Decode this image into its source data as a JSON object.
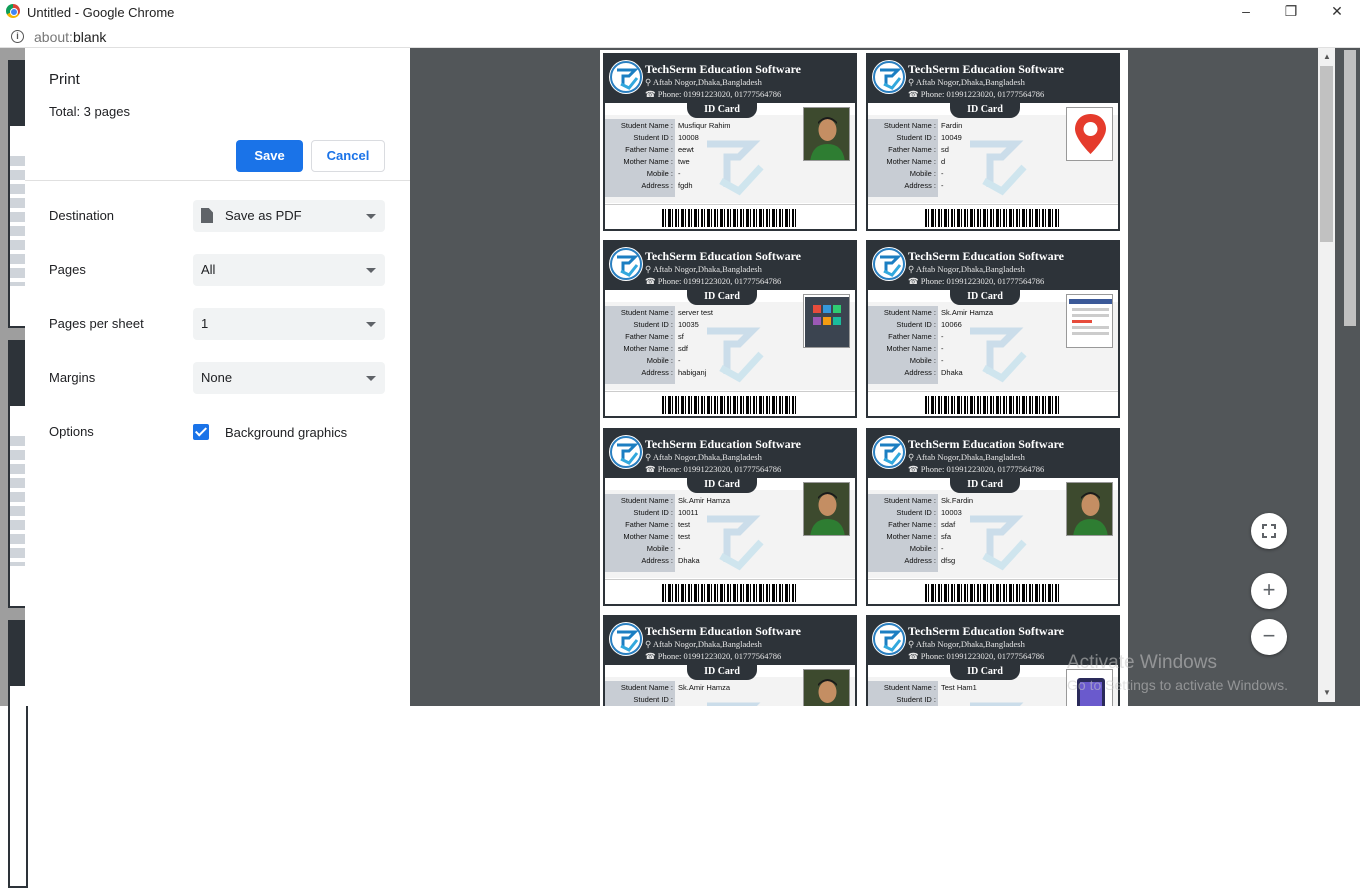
{
  "window": {
    "title": "Untitled - Google Chrome",
    "minimize": "–",
    "restore": "❐",
    "close": "✕"
  },
  "address": {
    "scheme": "about:",
    "path": "blank"
  },
  "print": {
    "title": "Print",
    "total": "Total: 3 pages",
    "save_label": "Save",
    "cancel_label": "Cancel",
    "options": {
      "destination": {
        "label": "Destination",
        "value": "Save as PDF"
      },
      "pages": {
        "label": "Pages",
        "value": "All"
      },
      "pages_per_sheet": {
        "label": "Pages per sheet",
        "value": "1"
      },
      "margins": {
        "label": "Margins",
        "value": "None"
      },
      "options": {
        "label": "Options",
        "checkbox_label": "Background graphics",
        "checked": true
      }
    }
  },
  "card_common": {
    "school": "TechSerm Education Software",
    "address": "Aftab Nogor,Dhaka,Bangladesh",
    "phone": "Phone: 01991223020, 01777564786",
    "id_title": "ID Card",
    "labels": {
      "name": "Student Name :",
      "id": "Student ID :",
      "father": "Father Name :",
      "mother": "Mother Name :",
      "mobile": "Mobile :",
      "address": "Address :"
    }
  },
  "cards": [
    {
      "name": "Musfiqur Rahim",
      "id": "10008",
      "father": "eewt",
      "mother": "twe",
      "mobile": "-",
      "address": "fgdh",
      "photo": "portrait"
    },
    {
      "name": "Fardin",
      "id": "10049",
      "father": "sd",
      "mother": "d",
      "mobile": "-",
      "address": "-",
      "photo": "location-pin"
    },
    {
      "name": "server test",
      "id": "10035",
      "father": "sf",
      "mother": "sdf",
      "mobile": "-",
      "address": "habiganj",
      "photo": "dashboard-screenshot"
    },
    {
      "name": "Sk.Amir Hamza",
      "id": "10066",
      "father": "-",
      "mother": "-",
      "mobile": "-",
      "address": "Dhaka",
      "photo": "form-screenshot"
    },
    {
      "name": "Sk.Amir Hamza",
      "id": "10011",
      "father": "test",
      "mother": "test",
      "mobile": "-",
      "address": "Dhaka",
      "photo": "portrait"
    },
    {
      "name": "Sk.Fardin",
      "id": "10003",
      "father": "sdaf",
      "mother": "sfa",
      "mobile": "-",
      "address": "dfsg",
      "photo": "portrait"
    },
    {
      "name": "Sk.Amir Hamza",
      "id": "",
      "father": "",
      "mother": "",
      "mobile": "",
      "address": "",
      "photo": "portrait"
    },
    {
      "name": "Test Ham1",
      "id": "",
      "father": "",
      "mother": "",
      "mobile": "",
      "address": "",
      "photo": "tablet"
    }
  ],
  "windows_notice": {
    "title": "Activate Windows",
    "subtitle": "Go to Settings to activate Windows."
  },
  "colors": {
    "card_header": "#2d3339",
    "save_button": "#1a73e8",
    "preview_bg": "#525659"
  }
}
